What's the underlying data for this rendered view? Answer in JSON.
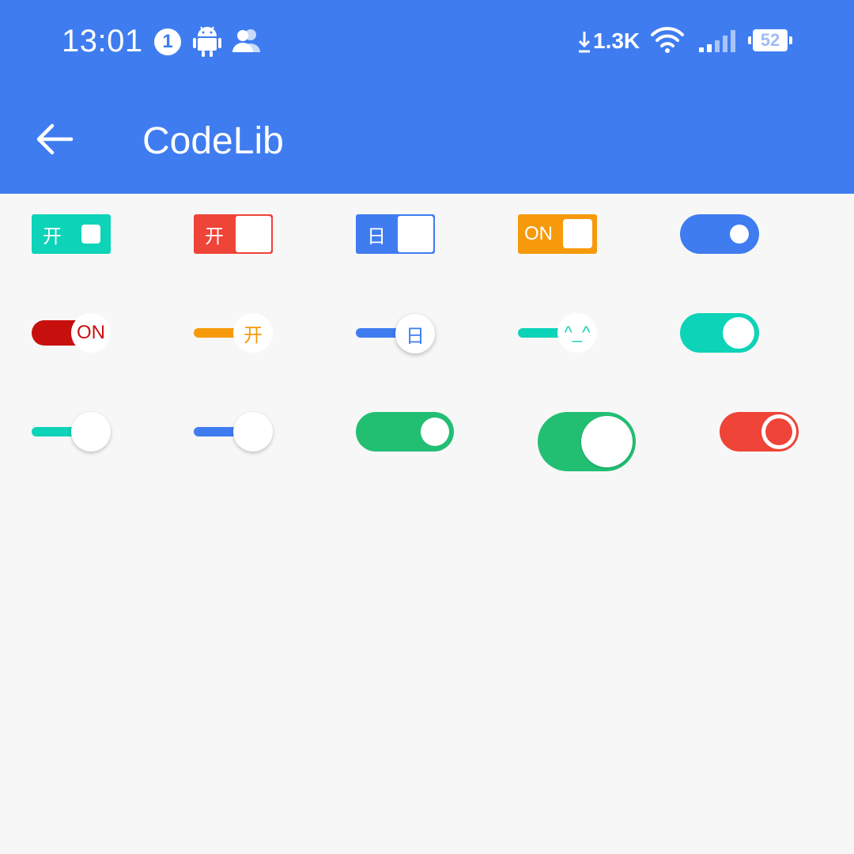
{
  "status_bar": {
    "time": "13:01",
    "notification_count": "1",
    "net_speed": "1.3K",
    "battery_level": "52",
    "icons": [
      "android-icon",
      "people-icon",
      "download-icon",
      "wifi-icon",
      "signal-icon",
      "battery-icon"
    ]
  },
  "app_bar": {
    "title": "CodeLib",
    "back_icon": "arrow-back-icon"
  },
  "colors": {
    "primary": "#3f7cf0",
    "teal": "#0dd3b8",
    "red": "#ef4438",
    "orange": "#f69a0c",
    "dark_red": "#c7100e",
    "green": "#22bf73"
  },
  "switches": {
    "row1": {
      "teal_square_label": "开",
      "red_square_label": "开",
      "blue_square_label": "日",
      "orange_square_label": "ON"
    },
    "row2": {
      "darkred_knob_label": "ON",
      "orange_knob_label": "开",
      "blue_knob_label": "日",
      "teal_knob_label": "^_^"
    }
  }
}
